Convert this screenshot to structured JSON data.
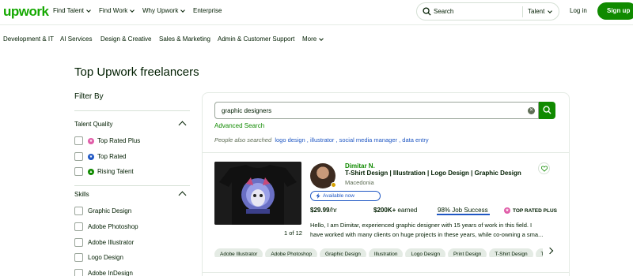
{
  "topnav": {
    "logo": "upwork",
    "links": [
      {
        "label": "Find Talent"
      },
      {
        "label": "Find Work"
      },
      {
        "label": "Why Upwork"
      },
      {
        "label": "Enterprise"
      }
    ],
    "search_placeholder": "Search",
    "search_scope": "Talent",
    "login": "Log in",
    "signup": "Sign up"
  },
  "categories": [
    "Development & IT",
    "AI Services",
    "Design & Creative",
    "Sales & Marketing",
    "Admin & Customer Support",
    "More"
  ],
  "page_title": "Top Upwork freelancers",
  "filters": {
    "heading": "Filter By",
    "talent_quality": {
      "title": "Talent Quality",
      "options": [
        "Top Rated Plus",
        "Top Rated",
        "Rising Talent"
      ]
    },
    "skills": {
      "title": "Skills",
      "options": [
        "Graphic Design",
        "Adobe Photoshop",
        "Adobe Illustrator",
        "Logo Design",
        "Adobe InDesign"
      ]
    }
  },
  "search": {
    "value": "graphic designers",
    "advanced": "Advanced Search",
    "also_label": "People also searched",
    "also": [
      "logo design ,",
      "illustrator ,",
      "social media manager ,",
      "data entry"
    ]
  },
  "freelancer": {
    "name": "Dimitar N.",
    "title": "T-Shirt Design | Illustration | Logo Design | Graphic Design",
    "location": "Macedonia",
    "availability": "Available now",
    "rate": "$29.99",
    "rate_unit": "/hr",
    "earned": "$200K+",
    "earned_label": " earned",
    "job_success": "98% Job Success",
    "badge": "TOP RATED PLUS",
    "portfolio_count": "1 of 12",
    "description": [
      "Hello, I am Dimitar, experienced graphic designer with 15 years of work in this field. I",
      "have worked with many clients on huge projects in these years, while co-owning a sma..."
    ],
    "skills": [
      "Adobe Illustrator",
      "Adobe Photoshop",
      "Graphic Design",
      "Illustration",
      "Logo Design",
      "Print Design",
      "T-Shirt Design",
      "T"
    ]
  },
  "colors": {
    "brand": "#14a800",
    "primary_button": "#108a00",
    "link": "#1f57c3",
    "top_rated_plus": "#e05da8",
    "top_rated": "#1f57c3",
    "rising_talent": "#108a00"
  }
}
